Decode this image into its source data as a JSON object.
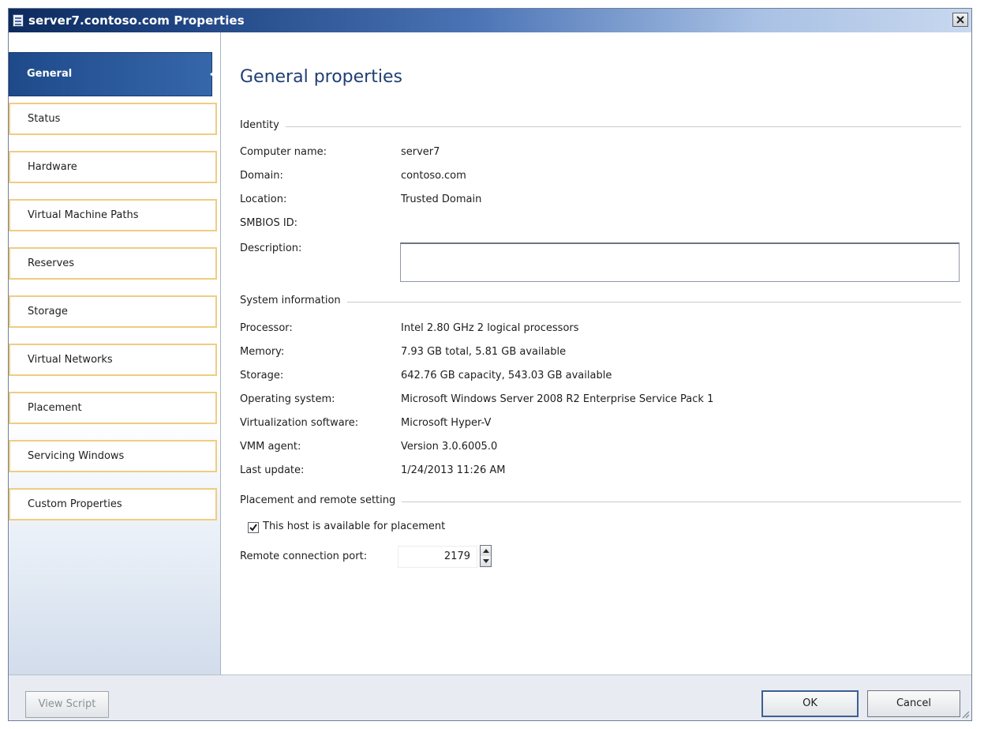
{
  "window": {
    "title": "server7.contoso.com Properties"
  },
  "sidebar": {
    "items": [
      {
        "label": "General",
        "active": true
      },
      {
        "label": "Status"
      },
      {
        "label": "Hardware"
      },
      {
        "label": "Virtual Machine Paths"
      },
      {
        "label": "Reserves"
      },
      {
        "label": "Storage"
      },
      {
        "label": "Virtual Networks"
      },
      {
        "label": "Placement"
      },
      {
        "label": "Servicing Windows"
      },
      {
        "label": "Custom Properties"
      }
    ]
  },
  "main": {
    "title": "General properties",
    "identity": {
      "section": "Identity",
      "computer_name_label": "Computer name:",
      "computer_name": "server7",
      "domain_label": "Domain:",
      "domain": "contoso.com",
      "location_label": "Location:",
      "location": "Trusted Domain",
      "smbios_label": "SMBIOS ID:",
      "description_label": "Description:",
      "description_value": ""
    },
    "system": {
      "section": "System information",
      "processor_label": "Processor:",
      "processor": "Intel  2.80 GHz 2 logical processors",
      "memory_label": "Memory:",
      "memory": "7.93 GB total, 5.81 GB available",
      "storage_label": "Storage:",
      "storage": "642.76 GB capacity, 543.03 GB available",
      "os_label": "Operating system:",
      "os": "Microsoft Windows Server 2008 R2 Enterprise  Service Pack 1",
      "virt_label": "Virtualization software:",
      "virt": "Microsoft Hyper-V",
      "agent_label": "VMM agent:",
      "agent": "Version 3.0.6005.0",
      "update_label": "Last update:",
      "update": "1/24/2013 11:26 AM"
    },
    "placement": {
      "section": "Placement and remote setting",
      "available_label": "This host is available for placement",
      "available_checked": true,
      "port_label": "Remote connection port:",
      "port_value": "2179"
    }
  },
  "footer": {
    "view_script": "View Script",
    "ok": "OK",
    "cancel": "Cancel"
  },
  "colors": {
    "title_bar": "#1f4582",
    "active_nav": "#2c5a9e",
    "nav_border": "#f0cc83",
    "page_title": "#1f3f73"
  }
}
